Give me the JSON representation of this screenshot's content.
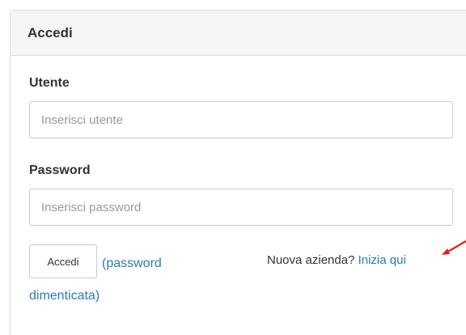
{
  "panel": {
    "title": "Accedi"
  },
  "form": {
    "user_label": "Utente",
    "user_placeholder": "Inserisci utente",
    "password_label": "Password",
    "password_placeholder": "Inserisci password",
    "submit_label": "Accedi",
    "forgot_line1": "(password",
    "forgot_line2": "dimenticata)"
  },
  "signup": {
    "prompt": "Nuova azienda?",
    "link": "Inizia qui"
  },
  "colors": {
    "link": "#2a7ab8",
    "annotation_arrow": "#e02020",
    "heading_bg": "#f5f5f5"
  },
  "icons": {
    "annotation": "red-arrow-icon"
  }
}
